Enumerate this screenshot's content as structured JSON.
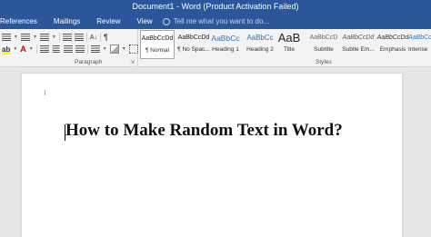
{
  "title_bar": {
    "title": "Document1 - Word (Product Activation Failed)"
  },
  "menu": {
    "items": [
      "References",
      "Mailings",
      "Review",
      "View"
    ],
    "tell_me_placeholder": "Tell me what you want to do..."
  },
  "ribbon": {
    "paragraph_label": "Paragraph",
    "styles_label": "Styles",
    "styles": [
      {
        "sample": "AaBbCcDd",
        "name": "¶ Normal"
      },
      {
        "sample": "AaBbCcDd",
        "name": "¶ No Spac..."
      },
      {
        "sample": "AaBbCc",
        "name": "Heading 1"
      },
      {
        "sample": "AaBbCc",
        "name": "Heading 2"
      },
      {
        "sample": "AaB",
        "name": "Title"
      },
      {
        "sample": "AaBbCcD",
        "name": "Subtitle"
      },
      {
        "sample": "AaBbCcDd",
        "name": "Subtle Em..."
      },
      {
        "sample": "AaBbCcDd",
        "name": "Emphasis"
      },
      {
        "sample": "AaBbCcDd",
        "name": "Intense"
      }
    ],
    "icons": [
      "bullets-icon",
      "numbering-icon",
      "multilevel-list-icon",
      "decrease-indent-icon",
      "increase-indent-icon",
      "sort-icon",
      "show-marks-icon",
      "align-left-icon",
      "center-icon",
      "align-right-icon",
      "justify-icon",
      "line-spacing-icon",
      "shading-icon",
      "borders-icon",
      "font-color-icon",
      "highlight-icon"
    ],
    "accent_color": "#2b579a"
  },
  "document": {
    "heading": "How to Make Random Text in Word?"
  }
}
